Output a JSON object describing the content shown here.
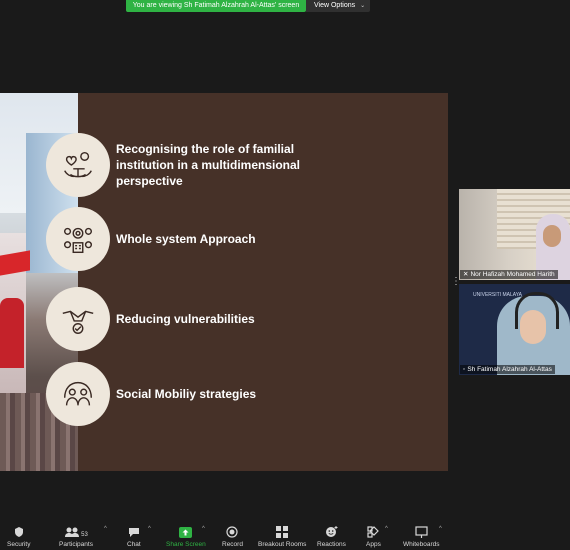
{
  "top": {
    "banner": "You are viewing Sh Fatimah Alzahrah Al-Attas' screen",
    "view_options": "View Options"
  },
  "slide": {
    "items": [
      {
        "label": "Recognising the role of familial institution in a multidimensional perspective"
      },
      {
        "label": "Whole system Approach"
      },
      {
        "label": "Reducing vulnerabilities"
      },
      {
        "label": "Social Mobiliy strategies"
      }
    ]
  },
  "participants_videos": [
    {
      "name": "Nor Hafizah Mohamed Harith"
    },
    {
      "name": "Sh Fatimah Alzahrah Al-Attas",
      "background_text": "UNIVERSITI MALAYA"
    }
  ],
  "toolbar": {
    "security": "Security",
    "participants": "Participants",
    "participants_count": "53",
    "chat": "Chat",
    "share_screen": "Share Screen",
    "record": "Record",
    "breakout_rooms": "Breakout Rooms",
    "reactions": "Reactions",
    "apps": "Apps",
    "whiteboards": "Whiteboards"
  },
  "colors": {
    "banner_green": "#2fb344",
    "slide_brown": "#463128",
    "icon_circle": "#eee7dc"
  }
}
